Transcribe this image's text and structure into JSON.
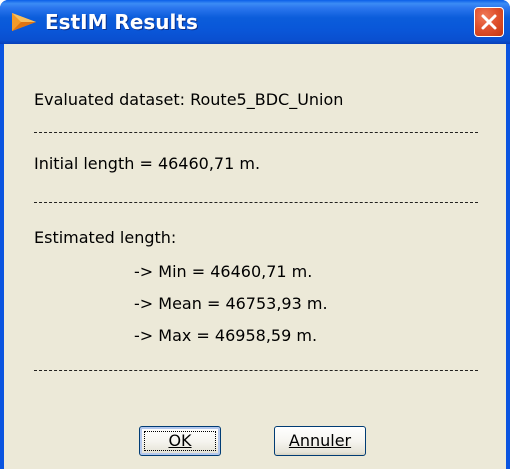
{
  "window": {
    "title": "EstIM Results"
  },
  "content": {
    "dataset_line": "Evaluated dataset: Route5_BDC_Union",
    "separator": "------------------------------------------------------------------",
    "initial_line": "Initial length = 46460,71 m.",
    "estimated_heading": "Estimated length:",
    "min_line": "-> Min    = 46460,71 m.",
    "mean_line": "-> Mean = 46753,93 m.",
    "max_line": "-> Max   = 46958,59 m."
  },
  "buttons": {
    "ok": "OK",
    "cancel": "Annuler"
  }
}
